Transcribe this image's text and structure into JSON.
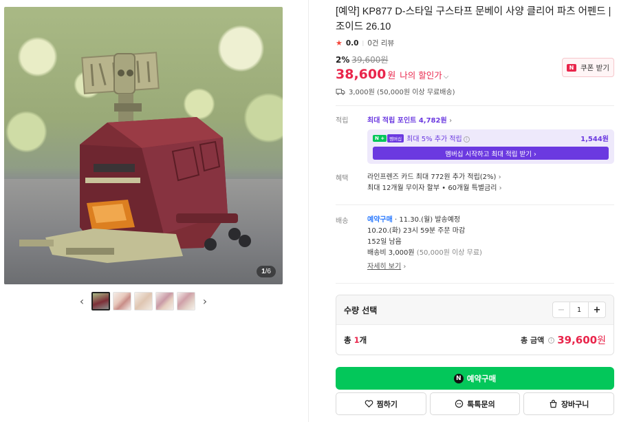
{
  "gallery": {
    "counter_current": "1",
    "counter_total": "/6",
    "prev_arrow": "‹",
    "next_arrow": "›"
  },
  "product": {
    "title": "[예약] KP877 D-스타일 구스타프 문베이 사양 클리어 파츠 어펜드 | 조이드 26.10",
    "rating": "0.0",
    "review_count": "0건 리뷰",
    "discount_pct": "2%",
    "original_price": "39,600원",
    "price": "38,600",
    "price_unit": "원",
    "my_discount": "나의 할인가",
    "coupon_label": "쿠폰 받기",
    "coupon_icon_text": "N",
    "shipping": "3,000원 (50,000원 이상 무료배송)"
  },
  "points": {
    "label": "적립",
    "max_points": "최대 적립 포인트 4,782원",
    "npay_badge": "N +",
    "member_badge": "멤버십",
    "member_text": "최대 5% 추가 적립",
    "member_amount": "1,544원",
    "member_button": "멤버십 시작하고 최대 적립 받기 ›"
  },
  "benefits": {
    "label": "혜택",
    "line1": "라인프렌즈 카드 최대 772원 추가 적립(2%)",
    "line2": "최대 12개월 무이자 할부 • 60개월 특별금리"
  },
  "delivery": {
    "label": "배송",
    "preorder": "예약구매",
    "ship_date": " · 11.30.(월) 발송예정",
    "deadline": "10.20.(화) 23시 59분 주문 마감",
    "remaining": "152일 남음",
    "fee": "배송비 3,000원",
    "fee_note": "(50,000원 이상 무료)",
    "more_link": "자세히 보기"
  },
  "quantity": {
    "label": "수량 선택",
    "minus": "−",
    "value": "1",
    "plus": "+",
    "total_prefix": "총 ",
    "total_count": "1",
    "total_suffix": "개",
    "total_label": "총 금액",
    "total_price": "39,600",
    "total_unit": "원"
  },
  "actions": {
    "buy": "예약구매",
    "buy_icon_text": "N",
    "wish": "찜하기",
    "talk": "톡톡문의",
    "cart": "장바구니"
  },
  "colors": {
    "price_red": "#e9254b",
    "naver_green": "#03c75a",
    "membership_purple": "#6b39e0",
    "preorder_blue": "#2979ff"
  }
}
